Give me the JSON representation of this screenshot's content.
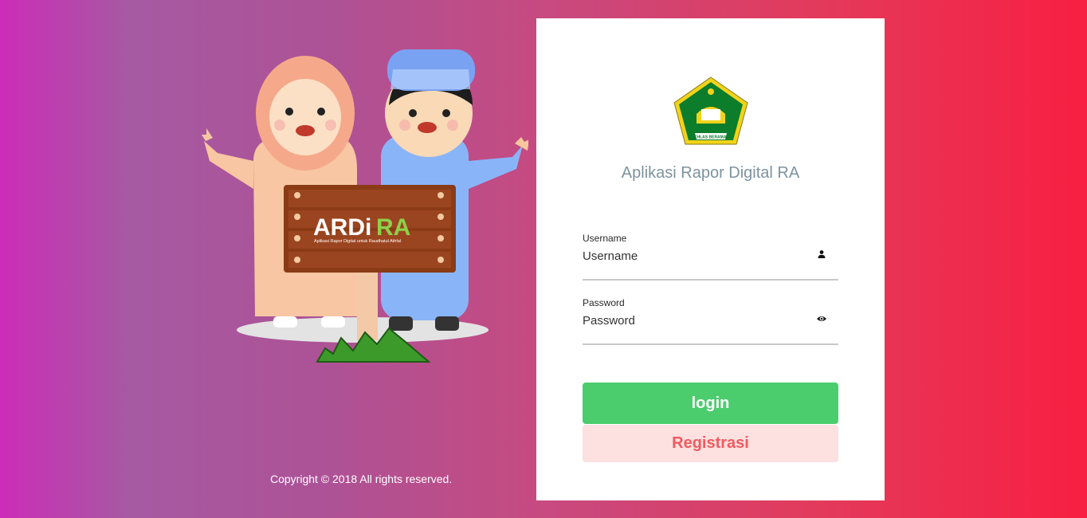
{
  "illustration": {
    "sign_logo_text_main": "ARDi",
    "sign_logo_text_accent": "RA",
    "sign_subtitle": "Aplikasi Rapor Digital untuk Raudhatul Athfal"
  },
  "footer": {
    "copyright": "Copyright © 2018 All rights reserved."
  },
  "login_card": {
    "emblem_text": "IKHLAS BERAMAL",
    "app_title": "Aplikasi Rapor Digital RA",
    "username": {
      "label": "Username",
      "placeholder": "Username",
      "value": "",
      "icon": "user-icon"
    },
    "password": {
      "label": "Password",
      "placeholder": "Password",
      "value": "",
      "icon": "eye-icon"
    },
    "login_button": "login",
    "register_button": "Registrasi"
  },
  "colors": {
    "login_green": "#4bcd6e",
    "register_bg": "#fde0e0",
    "register_text": "#f15a5f",
    "title_gray": "#7d939f"
  }
}
